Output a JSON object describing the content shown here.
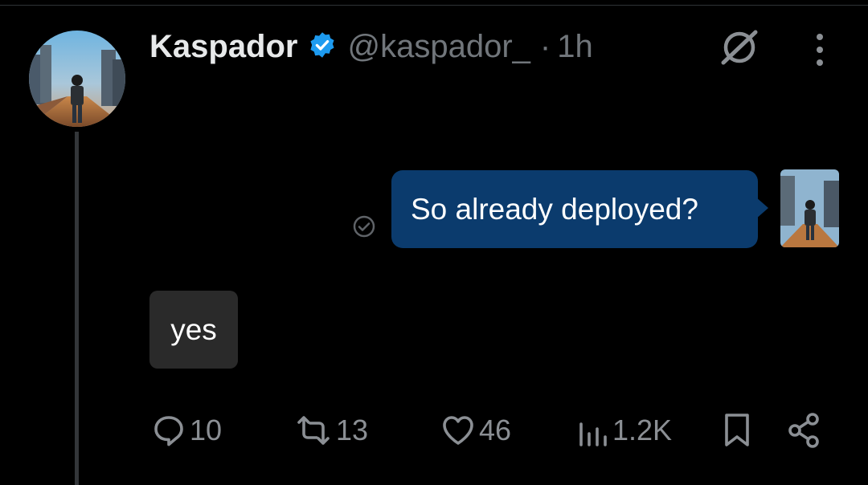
{
  "post": {
    "author_name": "Kaspador",
    "handle": "@kaspador_",
    "separator": "·",
    "time": "1h"
  },
  "messages": [
    {
      "side": "right",
      "text": "So already deployed?"
    },
    {
      "side": "left",
      "text": "yes"
    }
  ],
  "actions": {
    "replies": "10",
    "reposts": "13",
    "likes": "46",
    "views": "1.2K"
  },
  "icons": {
    "verified": "verified-badge-icon",
    "grok": "grok-icon",
    "more": "more-vertical-icon",
    "seen": "check-circle-icon",
    "reply": "reply-icon",
    "repost": "repost-icon",
    "like": "heart-icon",
    "views": "views-icon",
    "bookmark": "bookmark-icon",
    "share": "share-icon"
  },
  "colors": {
    "background": "#000000",
    "outgoing_bubble": "#0b3b6d",
    "incoming_bubble": "#2a2a2a",
    "verified": "#1d9bf0",
    "muted": "#71767b"
  }
}
